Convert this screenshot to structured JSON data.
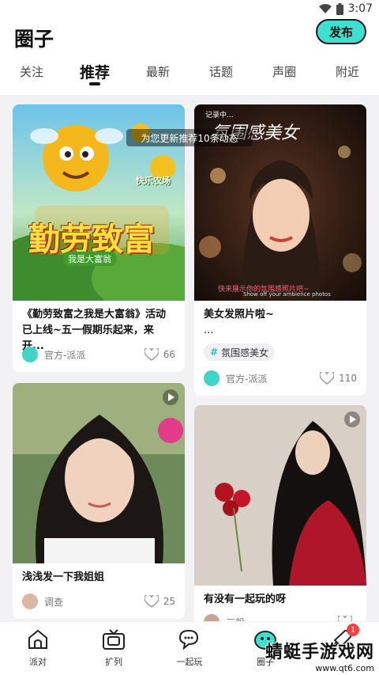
{
  "status": {
    "time": "3:07"
  },
  "header": {
    "title": "圈子",
    "publish_label": "发布"
  },
  "tabs": [
    {
      "label": "关注"
    },
    {
      "label": "推荐",
      "active": true
    },
    {
      "label": "最新"
    },
    {
      "label": "话题"
    },
    {
      "label": "声圈"
    },
    {
      "label": "附近"
    }
  ],
  "toast": "为您更新推荐10条动态",
  "cards": [
    {
      "title": "《勤劳致富之我是大富翁》活动已上线~五一假期乐起来，来开...",
      "author": "官方-派派",
      "likes": "66",
      "image_text": {
        "headline": "勤劳致富",
        "sub": "我是大富翁",
        "corner": "快乐农场"
      }
    },
    {
      "title": "美女发照片啦~",
      "title_more": "...",
      "tag": "氛围感美女",
      "author": "官方-派派",
      "likes": "110",
      "image_text": {
        "rec": "记录中...",
        "headline": "氛围感美女",
        "caption": "快来展示你的氛围感照片吧~",
        "caption_sub": "Show off your ambience photos"
      }
    },
    {
      "title": "浅浅发一下我姐姐",
      "author": "调查",
      "likes": "25"
    },
    {
      "title": "有没有一起玩的呀",
      "author": "三般",
      "likes": ""
    }
  ],
  "bottom_nav": [
    {
      "label": "派对",
      "icon": "home-icon"
    },
    {
      "label": "扩列",
      "icon": "tv-icon"
    },
    {
      "label": "一起玩",
      "icon": "chat-icon"
    },
    {
      "label": "圈子",
      "icon": "circle-icon"
    },
    {
      "label": "",
      "icon": "rocket-icon",
      "badge": "1"
    }
  ],
  "watermark": {
    "text": "蜻蜓手游戏网",
    "url": "www.qt6.com"
  },
  "colors": {
    "accent": "#3fe0cf",
    "badge": "#f04040"
  }
}
